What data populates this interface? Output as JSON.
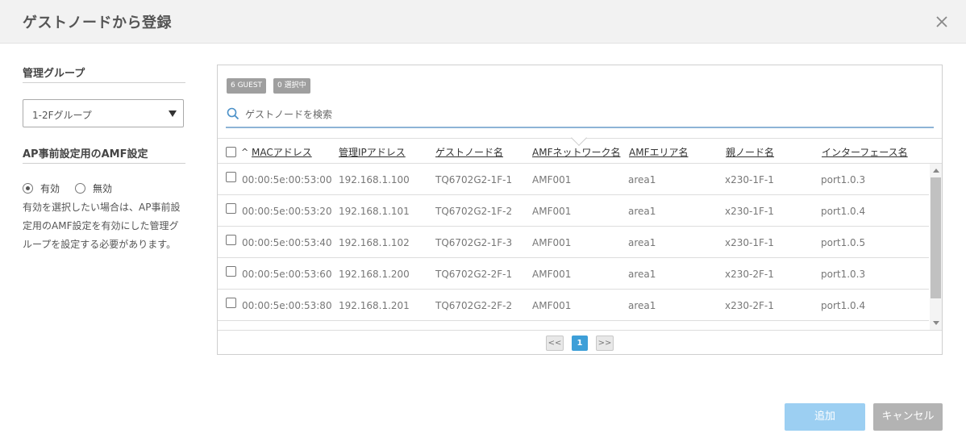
{
  "dialog": {
    "title": "ゲストノードから登録"
  },
  "left": {
    "group_label": "管理グループ",
    "group_value": "1-2Fグループ",
    "amf_label": "AP事前設定用のAMF設定",
    "radio_enabled": "有効",
    "radio_disabled": "無効",
    "selected_radio": "有効",
    "note": "有効を選択したい場合は、AP事前設定用のAMF設定を有効にした管理グループを設定する必要があります。"
  },
  "badges": {
    "guest": "6 GUEST",
    "selected": "0 選択中"
  },
  "search": {
    "placeholder": "ゲストノードを検索"
  },
  "table": {
    "sort_indicator": "^",
    "headers": [
      "MACアドレス",
      "管理IPアドレス",
      "ゲストノード名",
      "AMFネットワーク名",
      "AMFエリア名",
      "親ノード名",
      "インターフェース名"
    ],
    "rows": [
      [
        "00:00:5e:00:53:00",
        "192.168.1.100",
        "TQ6702G2-1F-1",
        "AMF001",
        "area1",
        "x230-1F-1",
        "port1.0.3"
      ],
      [
        "00:00:5e:00:53:20",
        "192.168.1.101",
        "TQ6702G2-1F-2",
        "AMF001",
        "area1",
        "x230-1F-1",
        "port1.0.4"
      ],
      [
        "00:00:5e:00:53:40",
        "192.168.1.102",
        "TQ6702G2-1F-3",
        "AMF001",
        "area1",
        "x230-1F-1",
        "port1.0.5"
      ],
      [
        "00:00:5e:00:53:60",
        "192.168.1.200",
        "TQ6702G2-2F-1",
        "AMF001",
        "area1",
        "x230-2F-1",
        "port1.0.3"
      ],
      [
        "00:00:5e:00:53:80",
        "192.168.1.201",
        "TQ6702G2-2F-2",
        "AMF001",
        "area1",
        "x230-2F-1",
        "port1.0.4"
      ]
    ]
  },
  "pager": {
    "prev": "<<",
    "current": "1",
    "next": ">>"
  },
  "buttons": {
    "add": "追加",
    "cancel": "キャンセル"
  },
  "colors": {
    "accent": "#3d9fd8",
    "add_button": "#9ccff2",
    "cancel_button": "#b3b3b3",
    "search_underline": "#8db4d6"
  },
  "icons": {
    "close": "close-icon",
    "search": "search-icon",
    "dropdown": "chevron-down-icon"
  }
}
